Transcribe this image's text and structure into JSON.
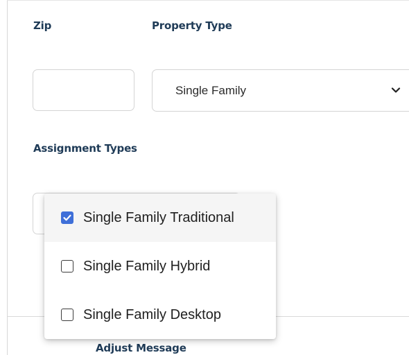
{
  "form": {
    "zip": {
      "label": "Zip",
      "value": "",
      "placeholder": ""
    },
    "property_type": {
      "label": "Property Type",
      "selected": "Single Family"
    },
    "assignment_types": {
      "label": "Assignment Types",
      "options": [
        {
          "label": "Single Family Traditional",
          "checked": true,
          "highlighted": true
        },
        {
          "label": "Single Family Hybrid",
          "checked": false,
          "highlighted": false
        },
        {
          "label": "Single Family Desktop",
          "checked": false,
          "highlighted": false
        }
      ]
    },
    "adjust_message": {
      "label": "Adjust Message"
    }
  },
  "colors": {
    "label_text": "#1f3b57",
    "checkbox_checked": "#3f6fd8",
    "highlight_row": "#f5f5f5",
    "border": "#d4d4d4"
  },
  "icons": {
    "select_chevron": "chevron-down-icon",
    "check": "checkmark-icon"
  }
}
